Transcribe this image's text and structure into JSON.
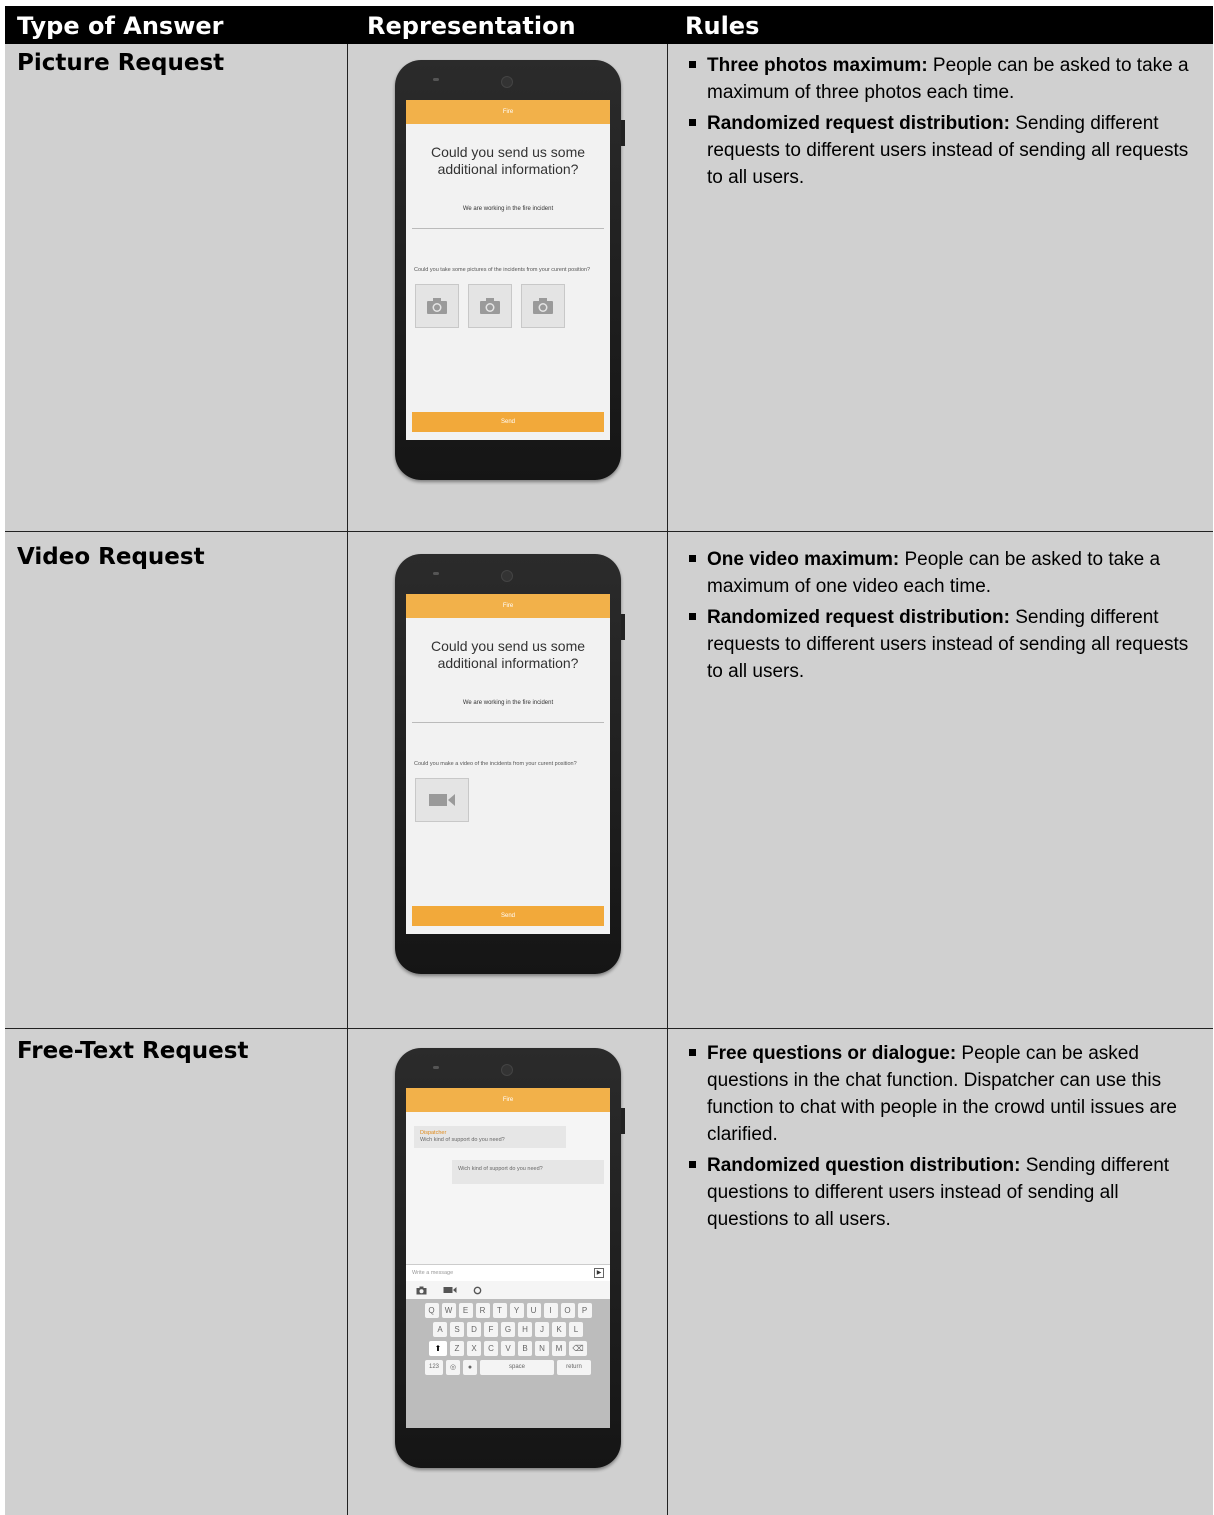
{
  "header": {
    "col1": "Type of Answer",
    "col2": "Representation",
    "col3": "Rules"
  },
  "rows": [
    {
      "title": "Picture Request",
      "rules": [
        {
          "bold": "Three photos maximum:",
          "text": " People can be asked to take a maximum of three photos each time."
        },
        {
          "bold": "Randomized request distribution:",
          "text": " Sending different requests to different users instead of sending all requests to all users."
        }
      ],
      "phone": {
        "topbar": "Fire",
        "question": "Could you send us some additional information?",
        "sub": "We are working in the fire incident",
        "prompt": "Could you take some pictures of the incidents from your curent position?",
        "send": "Send"
      }
    },
    {
      "title": "Video Request",
      "rules": [
        {
          "bold": "One video maximum:",
          "text": " People can be asked to take a maximum of one video each time."
        },
        {
          "bold": "Randomized request distribution:",
          "text": " Sending different requests to different users instead of sending all requests to all users."
        }
      ],
      "phone": {
        "topbar": "Fire",
        "question": "Could you send us some additional information?",
        "sub": "We are working in the fire incident",
        "prompt": "Could you make a video of the incidents from your curent position?",
        "send": "Send"
      }
    },
    {
      "title": "Free-Text Request",
      "rules": [
        {
          "bold": "Free questions or dialogue:",
          "text": " People can be asked questions in the chat function. Dispatcher can use this function to chat with people in the crowd until issues are clarified."
        },
        {
          "bold": "Randomized question distribution:",
          "text": " Sending different questions to different users instead of sending all questions to all users."
        }
      ],
      "phone": {
        "topbar": "Fire",
        "sender": "Dispatcher",
        "msg_in": "Wich kind of support do you need?",
        "msg_out": "Wich kind of support do you need?",
        "compose_placeholder": "Write a message",
        "keys_row1": [
          "Q",
          "W",
          "E",
          "R",
          "T",
          "Y",
          "U",
          "I",
          "O",
          "P"
        ],
        "keys_row2": [
          "A",
          "S",
          "D",
          "F",
          "G",
          "H",
          "J",
          "K",
          "L"
        ],
        "keys_row3": [
          "Z",
          "X",
          "C",
          "V",
          "B",
          "N",
          "M"
        ],
        "key_123": "123",
        "key_space": "space",
        "key_return": "return"
      }
    }
  ],
  "colors": {
    "header_bg": "#000000",
    "cell_bg": "#d0d0d0",
    "accent_orange": "#f2b14a"
  }
}
